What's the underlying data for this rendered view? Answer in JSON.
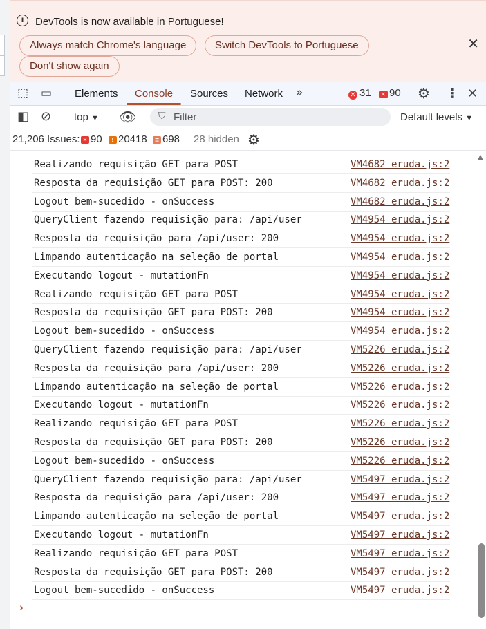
{
  "infobar": {
    "message": "DevTools is now available in Portuguese!",
    "buttons": [
      "Always match Chrome's language",
      "Switch DevTools to Portuguese",
      "Don't show again"
    ],
    "close_icon": "close-icon"
  },
  "tabs": {
    "items": [
      "Elements",
      "Console",
      "Sources",
      "Network"
    ],
    "active": "Console",
    "overflow_icon": "chevron-double-right-icon",
    "error_count": "31",
    "warning_count": "90"
  },
  "console_toolbar": {
    "context": "top",
    "filter_placeholder": "Filter",
    "levels": "Default levels"
  },
  "issues_bar": {
    "total": "21,206 Issues:",
    "errors": "90",
    "warnings": "20418",
    "info": "698",
    "hidden": "28 hidden"
  },
  "colors": {
    "accent": "#b3502d",
    "error": "#e53935",
    "warning": "#e8710a",
    "info": "#e57c5a",
    "infobar_bg": "#fcefeb"
  },
  "logs": [
    {
      "msg": "Realizando requisição GET para POST",
      "src": "VM4682 eruda.js:2"
    },
    {
      "msg": "Resposta da requisição GET para POST: 200",
      "src": "VM4682 eruda.js:2"
    },
    {
      "msg": "Logout bem-sucedido - onSuccess",
      "src": "VM4682 eruda.js:2"
    },
    {
      "msg": "QueryClient fazendo requisição para: /api/user",
      "src": "VM4954 eruda.js:2"
    },
    {
      "msg": "Resposta da requisição para /api/user: 200",
      "src": "VM4954 eruda.js:2"
    },
    {
      "msg": "Limpando autenticação na seleção de portal",
      "src": "VM4954 eruda.js:2"
    },
    {
      "msg": "Executando logout - mutationFn",
      "src": "VM4954 eruda.js:2"
    },
    {
      "msg": "Realizando requisição GET para POST",
      "src": "VM4954 eruda.js:2"
    },
    {
      "msg": "Resposta da requisição GET para POST: 200",
      "src": "VM4954 eruda.js:2"
    },
    {
      "msg": "Logout bem-sucedido - onSuccess",
      "src": "VM4954 eruda.js:2"
    },
    {
      "msg": "QueryClient fazendo requisição para: /api/user",
      "src": "VM5226 eruda.js:2"
    },
    {
      "msg": "Resposta da requisição para /api/user: 200",
      "src": "VM5226 eruda.js:2"
    },
    {
      "msg": "Limpando autenticação na seleção de portal",
      "src": "VM5226 eruda.js:2"
    },
    {
      "msg": "Executando logout - mutationFn",
      "src": "VM5226 eruda.js:2"
    },
    {
      "msg": "Realizando requisição GET para POST",
      "src": "VM5226 eruda.js:2"
    },
    {
      "msg": "Resposta da requisição GET para POST: 200",
      "src": "VM5226 eruda.js:2"
    },
    {
      "msg": "Logout bem-sucedido - onSuccess",
      "src": "VM5226 eruda.js:2"
    },
    {
      "msg": "QueryClient fazendo requisição para: /api/user",
      "src": "VM5497 eruda.js:2"
    },
    {
      "msg": "Resposta da requisição para /api/user: 200",
      "src": "VM5497 eruda.js:2"
    },
    {
      "msg": "Limpando autenticação na seleção de portal",
      "src": "VM5497 eruda.js:2"
    },
    {
      "msg": "Executando logout - mutationFn",
      "src": "VM5497 eruda.js:2"
    },
    {
      "msg": "Realizando requisição GET para POST",
      "src": "VM5497 eruda.js:2"
    },
    {
      "msg": "Resposta da requisição GET para POST: 200",
      "src": "VM5497 eruda.js:2"
    },
    {
      "msg": "Logout bem-sucedido - onSuccess",
      "src": "VM5497 eruda.js:2"
    }
  ]
}
